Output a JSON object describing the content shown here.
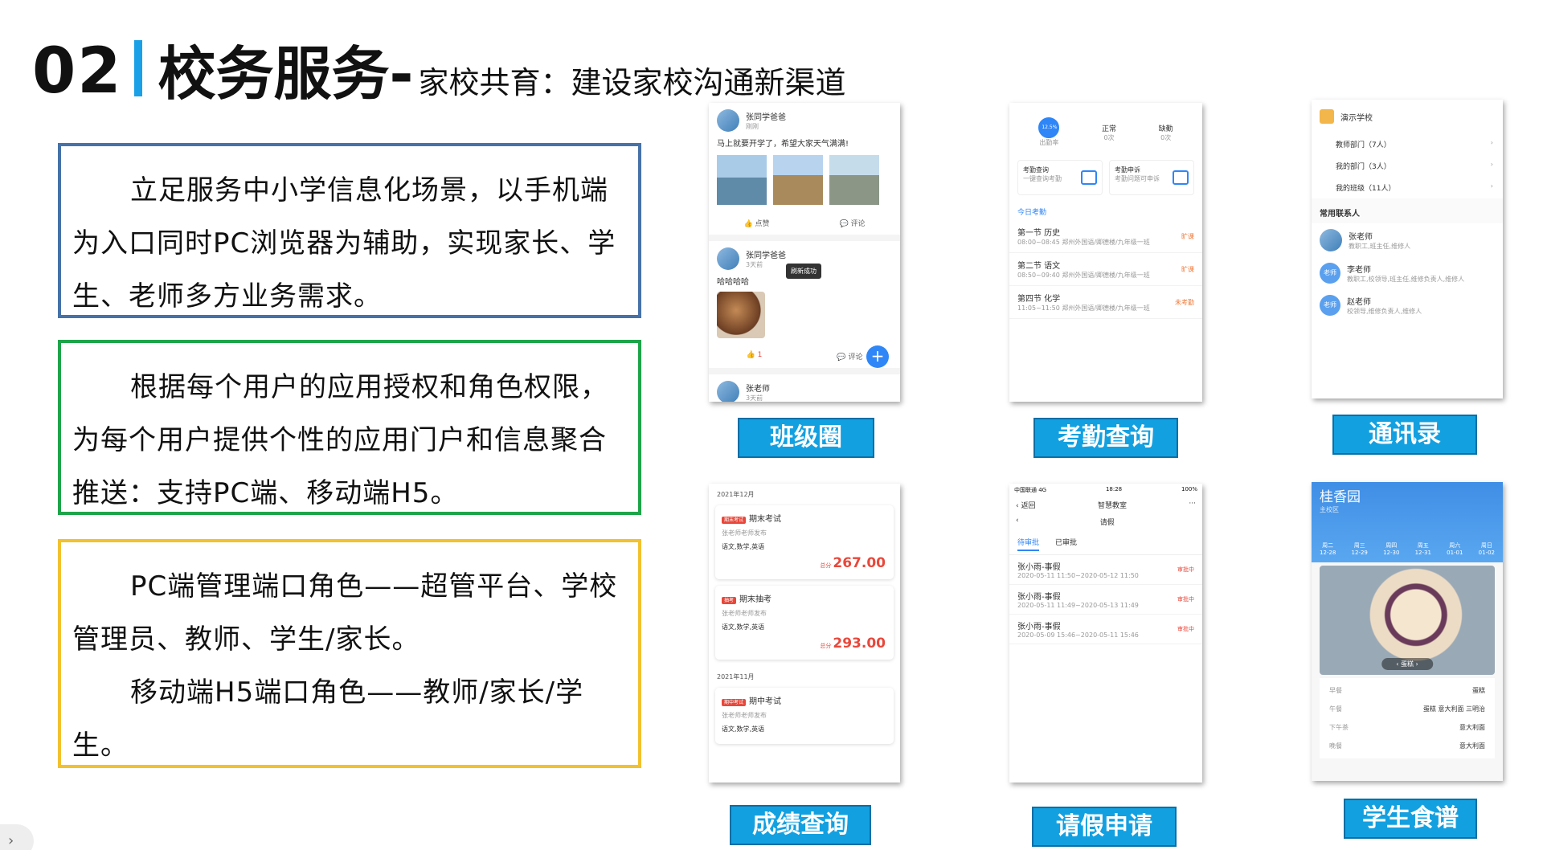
{
  "title": {
    "number": "02",
    "main": "校务服务-",
    "sub": "家校共育：建设家校沟通新渠道"
  },
  "boxes": {
    "box1": "立足服务中小学信息化场景，以手机端为入口同时PC浏览器为辅助，实现家长、学生、老师多方业务需求。",
    "box2": "根据每个用户的应用授权和角色权限，为每个用户提供个性的应用门户和信息聚合推送：支持PC端、移动端H5。",
    "box3_p1": "PC端管理端口角色——超管平台、学校管理员、教师、学生/家长。",
    "box3_p2": "移动端H5端口角色——教师/家长/学生。"
  },
  "labels": {
    "class_circle": "班级圈",
    "attendance": "考勤查询",
    "contacts": "通讯录",
    "grades": "成绩查询",
    "leave": "请假申请",
    "menu": "学生食谱"
  },
  "class_circle": {
    "post1_name": "张同学爸爸",
    "post1_time": "刚刚",
    "post1_text": "马上就要开学了，希望大家天气满满!",
    "like": "点赞",
    "comment": "评论",
    "post2_name": "张同学爸爸",
    "post2_time": "3天前",
    "post2_text": "哈哈哈哈",
    "toast": "刷新成功",
    "like_count": "1",
    "post3_name": "张老师",
    "post3_time": "3天前",
    "fab": "+"
  },
  "attendance": {
    "rate": "出勤率",
    "rate_value": "12.5%",
    "normal": "正常",
    "normal_count": "0次",
    "absent": "缺勤",
    "absent_count": "0次",
    "box1_title": "考勤查询",
    "box1_sub": "一键查询考勤",
    "box2_title": "考勤申诉",
    "box2_sub": "考勤问题可申诉",
    "today": "今日考勤",
    "rows": [
      {
        "title": "第一节 历史",
        "sub": "08:00~08:45 郑州外国语/卿德楼/九年级一班",
        "status": "旷课"
      },
      {
        "title": "第二节 语文",
        "sub": "08:50~09:40 郑州外国语/卿德楼/九年级一班",
        "status": "旷课"
      },
      {
        "title": "第四节 化学",
        "sub": "11:05~11:50 郑州外国语/卿德楼/九年级一班",
        "status": "未考勤"
      }
    ]
  },
  "contacts": {
    "school": "演示学校",
    "groups": [
      "教师部门（7人）",
      "我的部门（3人）",
      "我的班级（11人）"
    ],
    "frequent": "常用联系人",
    "people": [
      {
        "name": "张老师",
        "role": "教职工,班主任,维修人",
        "avatar": ""
      },
      {
        "name": "李老师",
        "role": "教职工,校领导,班主任,维修负责人,维修人",
        "avatar": "老师"
      },
      {
        "name": "赵老师",
        "role": "校领导,维修负责人,维修人",
        "avatar": "老师"
      }
    ]
  },
  "grades": {
    "month1": "2021年12月",
    "month2": "2021年11月",
    "total": "总分",
    "items": [
      {
        "tag": "期末考试",
        "title": "期末考试",
        "pub": "张老师老师发布",
        "subjects": "语文,数学,英语",
        "score": "267.00"
      },
      {
        "tag": "抽考",
        "title": "期末抽考",
        "pub": "张老师老师发布",
        "subjects": "语文,数学,英语",
        "score": "293.00"
      },
      {
        "tag": "期中考试",
        "title": "期中考试",
        "pub": "张老师老师发布",
        "subjects": "语文,数学,英语",
        "score": ""
      }
    ]
  },
  "leave": {
    "carrier": "中国联通 4G",
    "time": "18:28",
    "battery": "100%",
    "back": "返回",
    "page": "智慧教室",
    "title": "请假",
    "tab_pending": "待审批",
    "tab_done": "已审批",
    "rows": [
      {
        "title": "张小雨-事假",
        "sub": "2020-05-11 11:50~2020-05-12 11:50",
        "status": "审批中"
      },
      {
        "title": "张小雨-事假",
        "sub": "2020-05-11 11:49~2020-05-13 11:49",
        "status": "审批中"
      },
      {
        "title": "张小雨-事假",
        "sub": "2020-05-09 15:46~2020-05-11 15:46",
        "status": "审批中"
      }
    ]
  },
  "menu": {
    "title": "桂香园",
    "campus": "主校区",
    "days": [
      {
        "d": "周二",
        "date": "12-28"
      },
      {
        "d": "周三",
        "date": "12-29"
      },
      {
        "d": "周四",
        "date": "12-30"
      },
      {
        "d": "周五",
        "date": "12-31"
      },
      {
        "d": "周六",
        "date": "01-01"
      },
      {
        "d": "周日",
        "date": "01-02"
      }
    ],
    "dish": "蛋糕",
    "meals": [
      {
        "k": "早餐",
        "v": "蛋糕"
      },
      {
        "k": "午餐",
        "v": "蛋糕 意大利面 三明治"
      },
      {
        "k": "下午茶",
        "v": "意大利面"
      },
      {
        "k": "晚餐",
        "v": "意大利面"
      }
    ]
  },
  "nav": {
    "side_button": "›"
  }
}
